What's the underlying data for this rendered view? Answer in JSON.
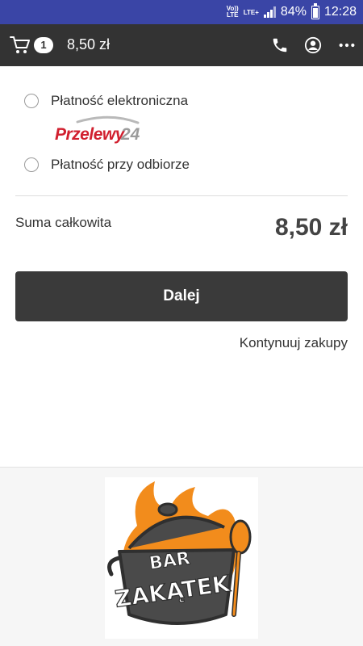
{
  "status_bar": {
    "volte": "Vo))\nLTE",
    "network": "LTE+",
    "battery": "84%",
    "time": "12:28"
  },
  "header": {
    "cart_count": "1",
    "cart_total": "8,50 zł",
    "icons": [
      "cart-icon",
      "phone-icon",
      "user-icon",
      "more-icon"
    ]
  },
  "payment": {
    "options": [
      {
        "label": "Płatność elektroniczna",
        "selected": false
      },
      {
        "label": "Płatność przy odbiorze",
        "selected": false
      }
    ],
    "provider_logo": "Przelewy24"
  },
  "summary": {
    "label": "Suma całkowita",
    "value": "8,50 zł"
  },
  "actions": {
    "next_label": "Dalej",
    "continue_label": "Kontynuuj zakupy"
  },
  "footer": {
    "logo_line1": "BAR",
    "logo_line2": "ZAKĄTEK"
  },
  "colors": {
    "status_bar": "#3a45a6",
    "header": "#333333",
    "button": "#3a3a3a",
    "p24_red": "#d1202f",
    "logo_orange": "#f28c1c"
  }
}
